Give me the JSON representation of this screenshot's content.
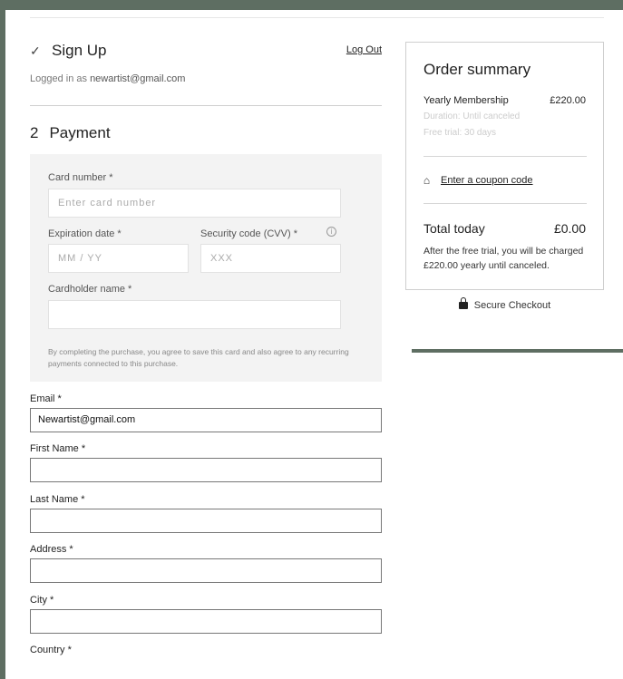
{
  "signup": {
    "title": "Sign Up",
    "logout_label": "Log Out",
    "logged_in_prefix": "Logged in as",
    "logged_in_email": "newartist@gmail.com"
  },
  "payment": {
    "step_number": "2",
    "title": "Payment",
    "card_number_label": "Card number *",
    "card_number_placeholder": "Enter card number",
    "expiration_label": "Expiration date *",
    "expiration_placeholder": "MM / YY",
    "cvv_label": "Security code (CVV) *",
    "cvv_placeholder": "XXX",
    "cardholder_label": "Cardholder name *",
    "cardholder_value": "",
    "disclaimer": "By completing the purchase, you agree to save this card and also agree to any recurring payments connected to this purchase."
  },
  "form": {
    "email_label": "Email *",
    "email_value": "Newartist@gmail.com",
    "first_name_label": "First Name *",
    "first_name_value": "",
    "last_name_label": "Last Name *",
    "last_name_value": "",
    "address_label": "Address *",
    "address_value": "",
    "city_label": "City *",
    "city_value": "",
    "country_label": "Country *"
  },
  "summary": {
    "title": "Order summary",
    "plan_name": "Yearly Membership",
    "plan_price": "£220.00",
    "duration": "Duration: Until canceled",
    "free_trial": "Free trial: 30 days",
    "coupon_label": "Enter a coupon code",
    "total_label": "Total today",
    "total_value": "£0.00",
    "after_trial_note": "After the free trial, you will be charged £220.00 yearly until canceled."
  },
  "secure_checkout": "Secure Checkout",
  "icons": {
    "check": "check-icon",
    "info": "info-icon",
    "tag": "tag-icon",
    "lock": "lock-icon"
  },
  "colors": {
    "frame": "#5e6e62",
    "card_box_bg": "#f3f3f3"
  }
}
